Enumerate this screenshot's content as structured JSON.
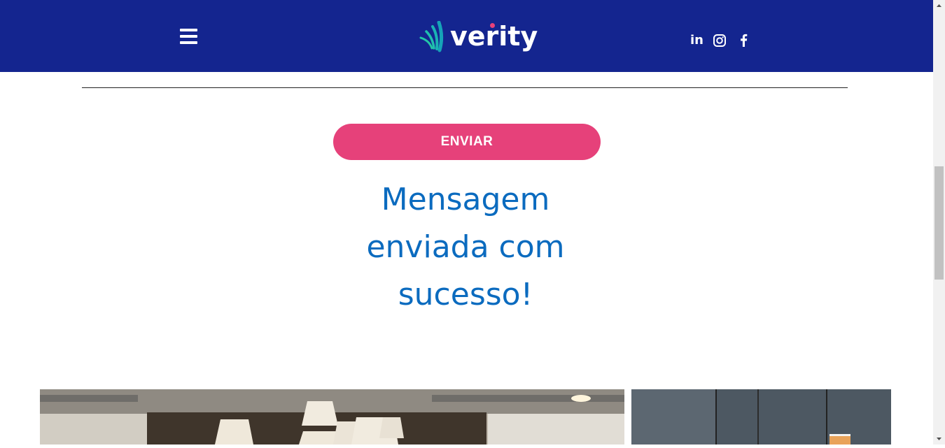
{
  "header": {
    "brand": "verity",
    "menu_icon": "hamburger-menu-icon",
    "social": [
      {
        "name": "linkedin",
        "label": "in"
      },
      {
        "name": "instagram"
      },
      {
        "name": "facebook"
      }
    ],
    "colors": {
      "background": "#14258f",
      "accent": "#e8417a",
      "logo_teal": "#1ab3b3"
    }
  },
  "form": {
    "submit_label": "ENVIAR",
    "button_color": "#e6417a"
  },
  "message": {
    "line1": "Mensagem",
    "line2": "enviada com",
    "line3": "sucesso!",
    "color": "#0b6bbf"
  }
}
